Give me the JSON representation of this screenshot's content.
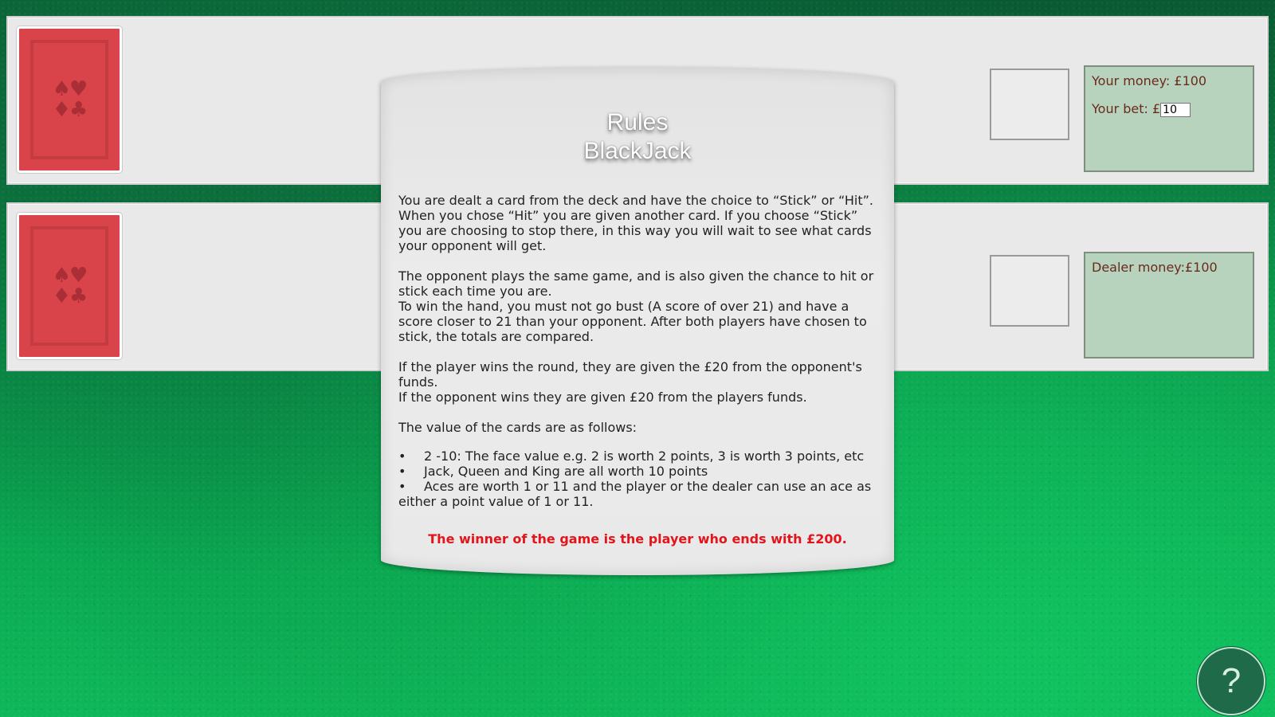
{
  "deck": {
    "suit_top": "♠♥",
    "suit_bottom": "♦♣"
  },
  "player": {
    "money_label": "Your money: £100",
    "bet_label": "Your bet: £",
    "bet_value": "10"
  },
  "dealer": {
    "money_label": "Dealer money:£100"
  },
  "rules": {
    "title_line1": "Rules",
    "title_line2": "BlackJack",
    "para1": "You are dealt a card from the deck and have the choice to “Stick” or “Hit”. When you chose “Hit” you are given another card. If you choose “Stick” you are choosing to stop there, in this way you will wait to see what cards your opponent will get.",
    "para2a": "The opponent plays the same game, and is also given the chance to hit or stick each time you are.",
    "para2b": "To win the hand, you must not go bust (A score of over 21) and have a score closer to 21 than your opponent. After both players have chosen to stick, the totals are compared.",
    "para3a": "If the player wins the round, they are given the £20 from the opponent's funds.",
    "para3b": "If the opponent wins they are given £20 from the players funds.",
    "values_heading": "The value of the cards are as follows:",
    "values": [
      "2 -10: The face value e.g. 2 is worth 2 points, 3 is worth 3 points, etc",
      "Jack, Queen and King are all worth 10 points",
      "Aces are worth 1 or 11 and the player or the dealer can use an ace as either a point value of 1 or 11."
    ],
    "winner": "The winner of the game is the player who ends with £200."
  },
  "help": {
    "label": "?"
  }
}
